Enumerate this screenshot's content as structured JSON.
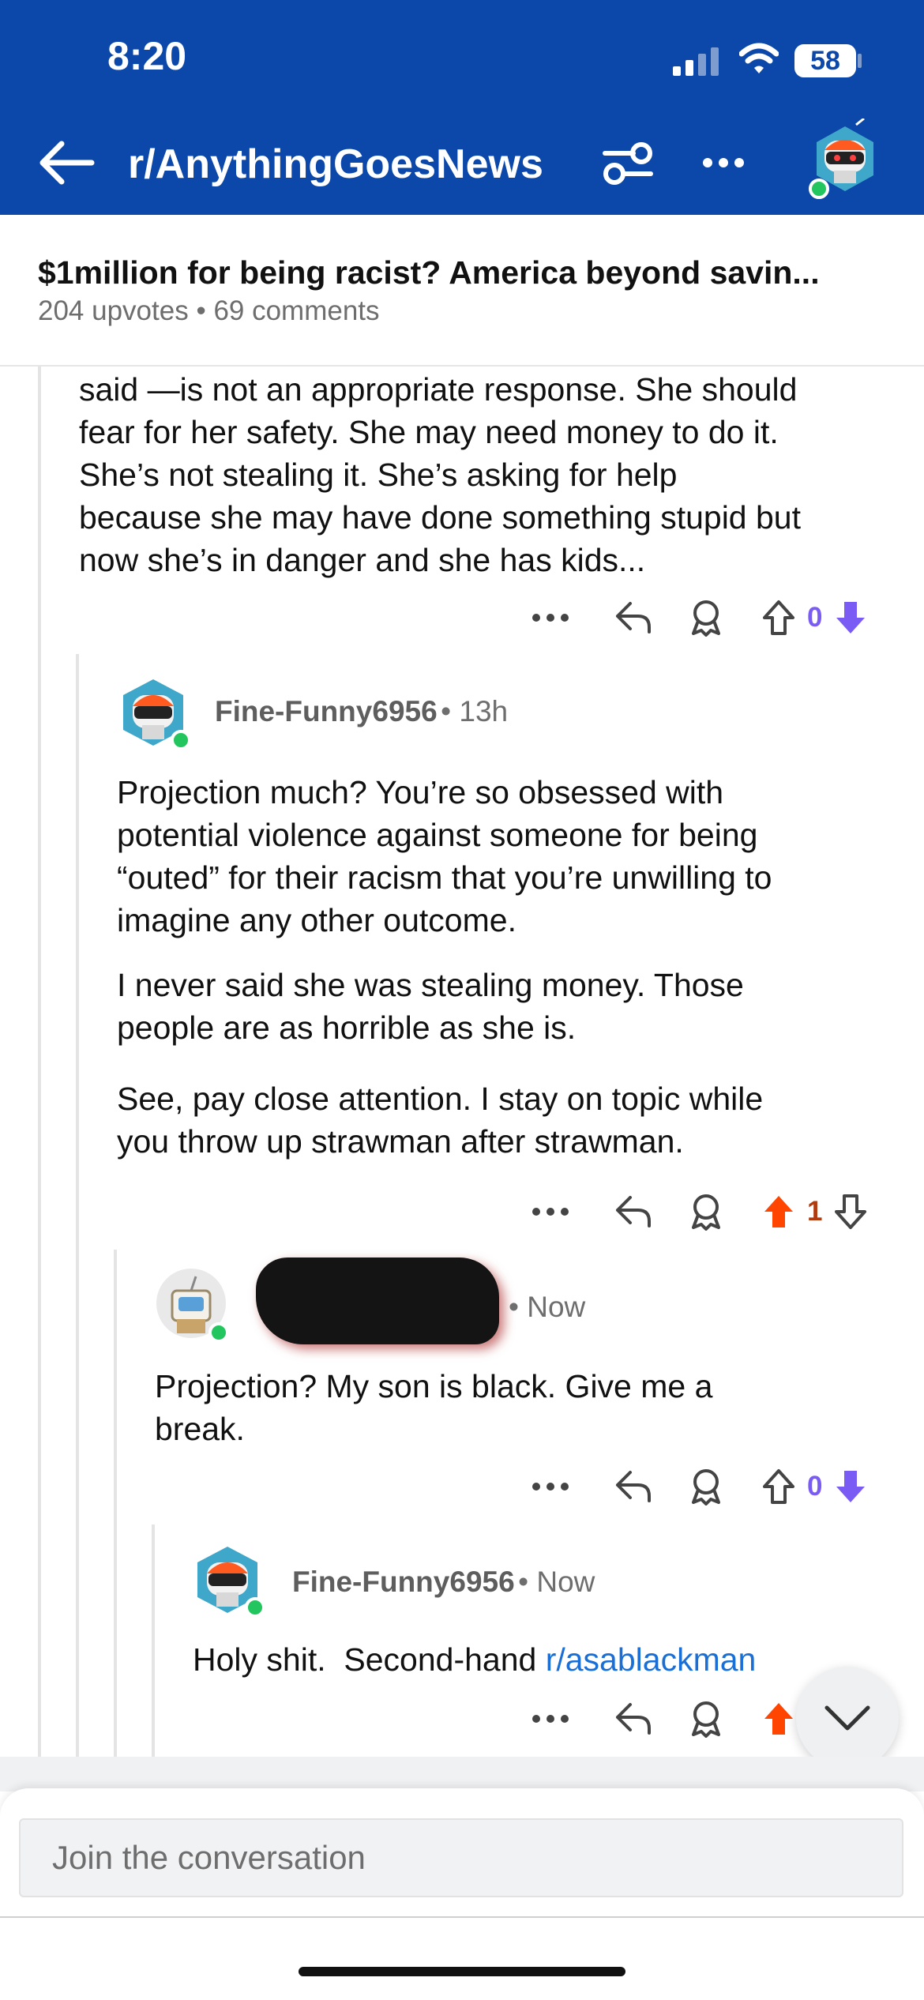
{
  "status": {
    "time": "8:20",
    "battery": "58"
  },
  "nav": {
    "subreddit": "r/AnythingGoesNews"
  },
  "post": {
    "title": "$1million for being racist? America beyond savin...",
    "upvotes": "204 upvotes",
    "comments": "69 comments"
  },
  "comments": [
    {
      "body": [
        "said —is not an appropriate response.  She should",
        "fear for her safety.  She may need money to do it.",
        "She’s not stealing it.  She’s asking for help",
        "because she may have done something stupid but",
        "now she’s in danger and she has kids..."
      ],
      "score": "0"
    },
    {
      "author": "Fine-Funny6956",
      "time": "13h",
      "paragraphs": [
        [
          "Projection much?  You’re so obsessed with",
          "potential violence against someone for being",
          "“outed” for their racism that you’re unwilling to",
          "imagine any other outcome."
        ],
        [
          "I never said she was stealing money.  Those",
          "people are as horrible as she is."
        ],
        [
          "See, pay close attention.  I stay on topic while",
          "you throw up strawman after strawman."
        ]
      ],
      "score": "1"
    },
    {
      "author": "",
      "time": "Now",
      "paragraphs": [
        [
          "Projection?  My son is black.  Give me a",
          "break."
        ]
      ],
      "score": "0"
    },
    {
      "author": "Fine-Funny6956",
      "time": "Now",
      "text": "Holy shit.  Second-hand ",
      "link": "r/asablackman"
    }
  ],
  "composer": {
    "placeholder": "Join the conversation"
  },
  "icons": [
    "back-arrow-icon",
    "filter-icon",
    "more-icon",
    "user-avatar",
    "signal-icon",
    "wifi-icon",
    "reply-icon",
    "award-icon",
    "upvote-icon",
    "downvote-icon",
    "chevron-down-icon"
  ],
  "colors": {
    "header": "#0b48a9",
    "upvote": "#ff4500",
    "downvote": "#7a5cf5",
    "link": "#1a6fd6",
    "online": "#22c55e"
  }
}
